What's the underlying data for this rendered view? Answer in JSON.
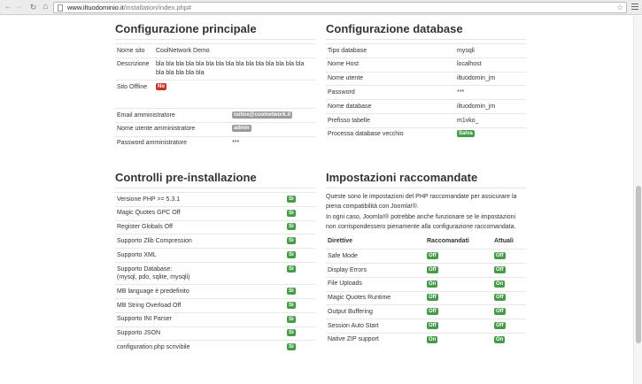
{
  "browser": {
    "url_host": "www.iltuodominio.it",
    "url_path": "/installation/index.php#"
  },
  "main_config": {
    "title": "Configurazione principale",
    "site_name_label": "Nome sito",
    "site_name_value": "CoolNetwork Demo",
    "description_label": "Descrizione",
    "description_value": "bla bla bla bla bla bla bla bla bla bla bla bla bla bla bla bla bla bla bla bla",
    "offline_label": "Sito Offline",
    "offline_value": "No",
    "admin_email_label": "Email amministratore",
    "admin_email_value": "notice@coolnetwork.it",
    "admin_user_label": "Nome utente amministratore",
    "admin_user_value": "admin",
    "admin_pass_label": "Password amministratore",
    "admin_pass_value": "***"
  },
  "db_config": {
    "title": "Configurazione database",
    "rows": [
      {
        "label": "Tipo database",
        "value": "mysqli"
      },
      {
        "label": "Nome Host",
        "value": "localhost"
      },
      {
        "label": "Nome utente",
        "value": "iltuodomin_jm"
      },
      {
        "label": "Password",
        "value": "***"
      },
      {
        "label": "Nome database",
        "value": "iltuodomin_jm"
      },
      {
        "label": "Prefisso tabelle",
        "value": "m1vko_"
      }
    ],
    "old_db_label": "Processa database vecchio",
    "old_db_value": "Salva"
  },
  "preinstall": {
    "title": "Controlli pre-installazione",
    "rows": [
      {
        "label": "Versione PHP >= 5.3.1",
        "value": "Sì"
      },
      {
        "label": "Magic Quotes GPC Off",
        "value": "Sì"
      },
      {
        "label": "Register Globals Off",
        "value": "Sì"
      },
      {
        "label": "Supporto Zlib Compression",
        "value": "Sì"
      },
      {
        "label": "Supporto XML",
        "value": "Sì"
      },
      {
        "label": "Supporto Database:",
        "label2": "(mysql, pdo, sqlite, mysqli)",
        "value": "Sì"
      },
      {
        "label": "MB language è predefinito",
        "value": "Sì"
      },
      {
        "label": "MB String Overload Off",
        "value": "Sì"
      },
      {
        "label": "Supporto INI Parser",
        "value": "Sì"
      },
      {
        "label": "Supporto JSON",
        "value": "Sì"
      },
      {
        "label": "configuration.php scrivibile",
        "value": "Sì"
      }
    ]
  },
  "recommended": {
    "title": "Impostazioni raccomandate",
    "intro1": "Queste sono le impostazioni del PHP raccomandate per assicurare la piena compatibilità con Joomla!®.",
    "intro2": "In ogni caso, Joomla!® potrebbe anche funzionare se le impostazioni non corrispondessero pienamente alla configurazione raccomandata.",
    "headers": {
      "directive": "Direttive",
      "recommended": "Raccomandati",
      "actual": "Attuali"
    },
    "rows": [
      {
        "label": "Safe Mode",
        "rec": "Off",
        "act": "Off"
      },
      {
        "label": "Display Errors",
        "rec": "Off",
        "act": "Off"
      },
      {
        "label": "File Uploads",
        "rec": "On",
        "act": "On"
      },
      {
        "label": "Magic Quotes Runtime",
        "rec": "Off",
        "act": "Off"
      },
      {
        "label": "Output Buffering",
        "rec": "Off",
        "act": "Off"
      },
      {
        "label": "Session Auto Start",
        "rec": "Off",
        "act": "Off"
      },
      {
        "label": "Native ZIP support",
        "rec": "On",
        "act": "On"
      }
    ]
  }
}
